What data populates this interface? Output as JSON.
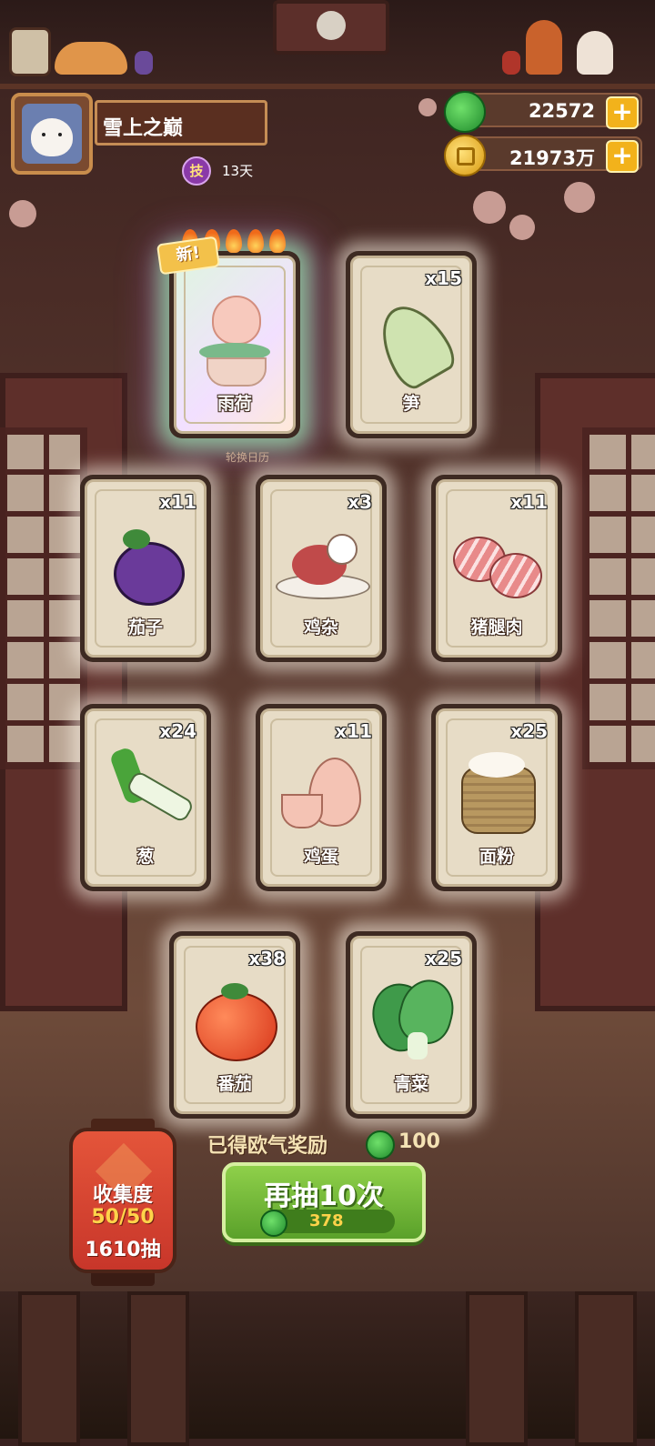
{
  "header": {
    "player_name": "雪上之巅",
    "skill_badge": "技",
    "days": "13天",
    "gems": "22572",
    "coins": "21973万",
    "plus": "+"
  },
  "cards": [
    {
      "name": "雨荷",
      "count": "",
      "is_new": true,
      "new_label": "新!",
      "icon": "lotus-peach-icon"
    },
    {
      "name": "笋",
      "count": "x15",
      "icon": "bamboo-shoot-icon"
    },
    {
      "name": "茄子",
      "count": "x11",
      "icon": "eggplant-icon"
    },
    {
      "name": "鸡杂",
      "count": "x3",
      "icon": "chicken-giblets-icon"
    },
    {
      "name": "猪腿肉",
      "count": "x11",
      "icon": "pork-leg-icon"
    },
    {
      "name": "葱",
      "count": "x24",
      "icon": "scallion-icon"
    },
    {
      "name": "鸡蛋",
      "count": "x11",
      "icon": "egg-icon"
    },
    {
      "name": "面粉",
      "count": "x25",
      "icon": "flour-sack-icon"
    },
    {
      "name": "番茄",
      "count": "x38",
      "icon": "tomato-icon"
    },
    {
      "name": "青菜",
      "count": "x25",
      "icon": "bok-choy-icon"
    }
  ],
  "rotation_note": "轮换日历",
  "reward": {
    "label": "已得欧气奖励",
    "value": "100"
  },
  "draw_button": {
    "label": "再抽10次",
    "cost": "378"
  },
  "collection": {
    "title": "收集度",
    "progress": "50/50",
    "draws": "1610抽"
  },
  "colors": {
    "accent_green": "#5aa12a",
    "gold": "#f2b21b",
    "lantern_red": "#d8452f"
  }
}
